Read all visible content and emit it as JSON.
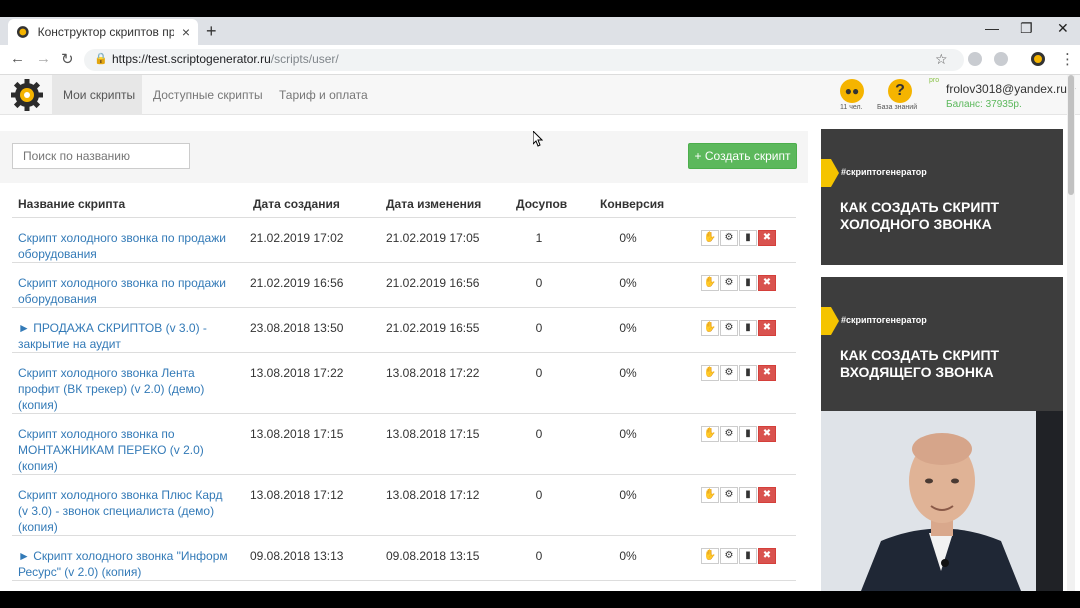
{
  "browser": {
    "tab_title": "Конструктор скриптов продаж",
    "url_host": "https://test.scriptogenerator.ru",
    "url_path": "/scripts/user/"
  },
  "header": {
    "nav": [
      "Мои скрипты",
      "Доступные скрипты",
      "Тариф и оплата"
    ],
    "team_caption": "11 чел.",
    "kb_caption": "База знаний",
    "kb_icon": "?",
    "pro_badge": "pro",
    "user_email": "frolov3018@yandex.ru",
    "balance": "Баланс: 37935р."
  },
  "toolbar": {
    "search_placeholder": "Поиск по названию",
    "create_label": "+ Создать скрипт"
  },
  "table": {
    "columns": [
      "Название скрипта",
      "Дата создания",
      "Дата изменения",
      "Досупов",
      "Конверсия"
    ],
    "rows": [
      {
        "name": "Скрипт холодного звонка по продажи оборудования",
        "created": "21.02.2019 17:02",
        "changed": "21.02.2019 17:05",
        "access": "1",
        "conv": "0%"
      },
      {
        "name": "Скрипт холодного звонка по продажи оборудования",
        "created": "21.02.2019 16:56",
        "changed": "21.02.2019 16:56",
        "access": "0",
        "conv": "0%"
      },
      {
        "name": "► ПРОДАЖА СКРИПТОВ (v 3.0) - закрытие на аудит",
        "created": "23.08.2018 13:50",
        "changed": "21.02.2019 16:55",
        "access": "0",
        "conv": "0%"
      },
      {
        "name": "Скрипт холодного звонка Лента профит (ВК трекер) (v 2.0) (демо) (копия)",
        "created": "13.08.2018 17:22",
        "changed": "13.08.2018 17:22",
        "access": "0",
        "conv": "0%"
      },
      {
        "name": "Скрипт холодного звонка по МОНТАЖНИКАМ ПЕРЕКО (v 2.0) (копия)",
        "created": "13.08.2018 17:15",
        "changed": "13.08.2018 17:15",
        "access": "0",
        "conv": "0%"
      },
      {
        "name": "Скрипт холодного звонка Плюс Кард (v 3.0) - звонок специалиста (демо) (копия)",
        "created": "13.08.2018 17:12",
        "changed": "13.08.2018 17:12",
        "access": "0",
        "conv": "0%"
      },
      {
        "name": "► Скрипт холодного звонка \"Информ Ресурс\" (v 2.0) (копия)",
        "created": "09.08.2018 13:13",
        "changed": "09.08.2018 13:15",
        "access": "0",
        "conv": "0%"
      }
    ],
    "action_icons": {
      "copy": "✋",
      "settings": "⚙",
      "stats": "▮",
      "delete": "✖"
    }
  },
  "promos": [
    {
      "hashtag": "#скриптогенератор",
      "line1": "КАК СОЗДАТЬ СКРИПТ",
      "line2": "ХОЛОДНОГО ЗВОНКА"
    },
    {
      "hashtag": "#скриптогенератор",
      "line1": "КАК СОЗДАТЬ СКРИПТ",
      "line2": "ВХОДЯЩЕГО ЗВОНКА"
    }
  ],
  "colors": {
    "accent_green": "#5cb85c",
    "link": "#337ab7",
    "delete_red": "#d9534f",
    "promo_yellow": "#f5c400"
  }
}
